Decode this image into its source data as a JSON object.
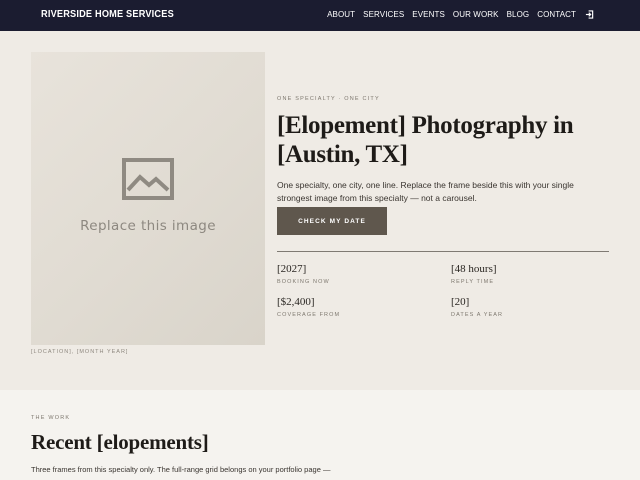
{
  "nav": {
    "brand": "RIVERSIDE HOME SERVICES",
    "items": [
      "ABOUT",
      "SERVICES",
      "EVENTS",
      "OUR WORK",
      "BLOG",
      "CONTACT"
    ],
    "login_icon": "sign-in-icon"
  },
  "hero": {
    "image_placeholder": "Replace this image",
    "image_icon": "image-placeholder-icon",
    "image_credit": "[LOCATION], [MONTH YEAR]",
    "eyebrow": "ONE SPECIALTY · ONE CITY",
    "headline": "[Elopement] Photography in [Austin, TX]",
    "lede": "One specialty, one city, one line. Replace the frame beside this with your single strongest image from this specialty — not a carousel.",
    "cta_label": "CHECK MY DATE",
    "stats": [
      {
        "value": "[2027]",
        "label": "BOOKING NOW"
      },
      {
        "value": "[48 hours]",
        "label": "REPLY TIME"
      },
      {
        "value": "[$2,400]",
        "label": "COVERAGE FROM"
      },
      {
        "value": "[20]",
        "label": "DATES A YEAR"
      }
    ]
  },
  "work": {
    "eyebrow": "THE WORK",
    "title": "Recent [elopements]",
    "text": "Three frames from this specialty only. The full-range grid belongs on your portfolio page —"
  },
  "colors": {
    "nav_bg": "#1b1c30",
    "hero_bg": "#efebe5",
    "cta_bg": "#5f574d",
    "section_bg": "#f5f3ef"
  }
}
